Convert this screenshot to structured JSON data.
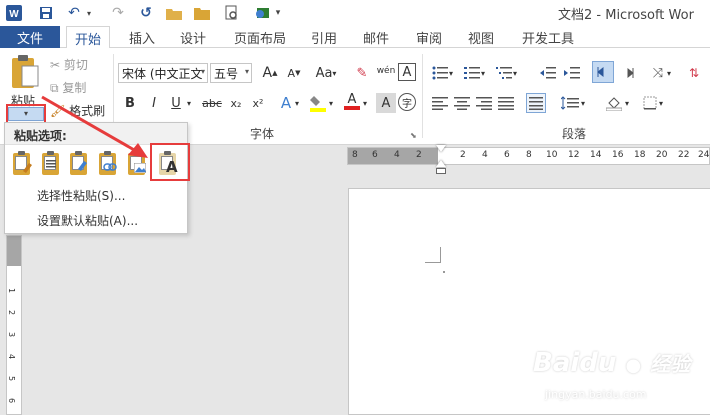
{
  "titlebar": {
    "title": "文档2 - Microsoft Wor"
  },
  "tabs": {
    "file": "文件",
    "items": [
      "开始",
      "插入",
      "设计",
      "页面布局",
      "引用",
      "邮件",
      "审阅",
      "视图",
      "开发工具"
    ]
  },
  "clipboard": {
    "paste_label": "粘贴",
    "cut": "剪切",
    "copy": "复制",
    "format_painter": "格式刷"
  },
  "font": {
    "group_label": "字体",
    "font_name": "宋体 (中文正文",
    "font_size": "五号",
    "grow": "A",
    "shrink": "A",
    "case": "Aa",
    "bold": "B",
    "italic": "I",
    "underline": "U",
    "strike": "abc",
    "sub": "x₂",
    "sup": "x²",
    "phonetic": "wén",
    "char_border": "A",
    "effects": "A",
    "font_color": "A",
    "shading": "A",
    "enclose": "字"
  },
  "paragraph": {
    "group_label": "段落"
  },
  "paste_menu": {
    "header": "粘贴选项:",
    "paste_special": "选择性粘贴(S)...",
    "set_default": "设置默认粘贴(A)..."
  },
  "ruler": {
    "h_numbers": [
      "8",
      "6",
      "4",
      "2",
      "2",
      "4",
      "6",
      "8",
      "10",
      "12",
      "14",
      "16",
      "18",
      "20",
      "22",
      "24"
    ],
    "v_numbers": [
      "1",
      "2",
      "3",
      "4",
      "5",
      "6"
    ]
  },
  "watermark": {
    "brand": "Baidu",
    "brand_cn": "经验",
    "url": "jingyan.baidu.com"
  },
  "colors": {
    "accent": "#2b579a",
    "highlight": "#e63c3c",
    "paste_gold": "#d9a536"
  }
}
